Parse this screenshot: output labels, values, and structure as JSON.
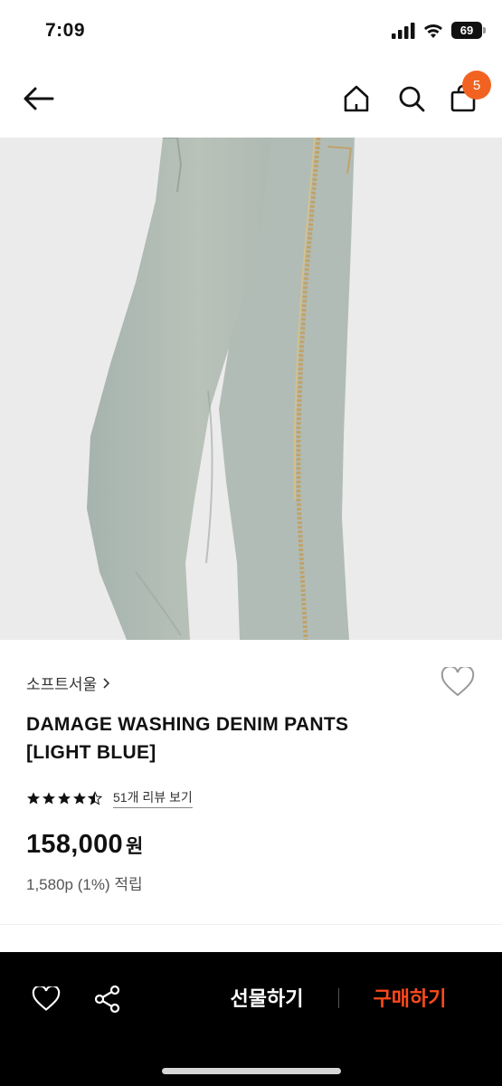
{
  "status_bar": {
    "time": "7:09",
    "battery": "69"
  },
  "nav": {
    "cart_count": "5"
  },
  "product": {
    "brand": "소프트서울",
    "name_line1": "DAMAGE WASHING DENIM PANTS",
    "name_line2": "[LIGHT BLUE]",
    "rating": 4.5,
    "review_link": "51개 리뷰 보기",
    "price": "158,000",
    "currency": "원",
    "points": "1,580p (1%) 적립"
  },
  "bottom_bar": {
    "gift_label": "선물하기",
    "buy_label": "구매하기"
  },
  "colors": {
    "accent": "#f26322",
    "buy_text": "#ff4a1c",
    "bottom_bg": "#000000"
  }
}
